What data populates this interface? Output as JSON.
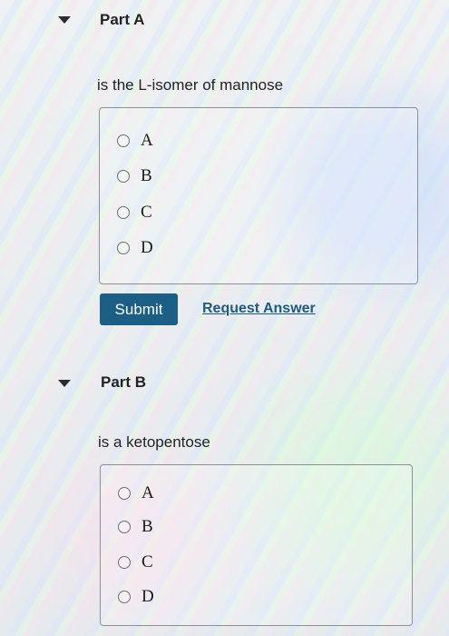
{
  "part_a": {
    "title": "Part A",
    "prompt": "is the L-isomer of mannose",
    "options": [
      "A",
      "B",
      "C",
      "D"
    ],
    "submit_label": "Submit",
    "request_label": "Request Answer"
  },
  "part_b": {
    "title": "Part B",
    "prompt": "is a ketopentose",
    "options": [
      "A",
      "B",
      "C",
      "D"
    ]
  },
  "colors": {
    "submit_bg": "#1b5e86",
    "link": "#1d5a85",
    "border": "#8e9093"
  },
  "icons": {
    "collapse_toggle": "triangle-down-icon",
    "radio": "radio-empty-icon"
  }
}
